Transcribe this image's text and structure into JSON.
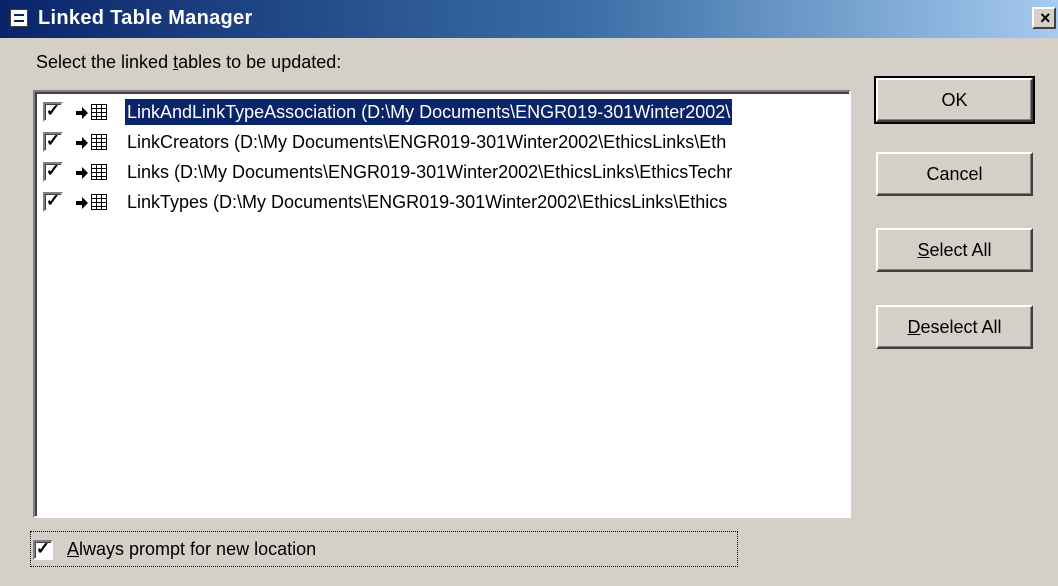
{
  "window": {
    "title": "Linked Table Manager",
    "close_glyph": "×"
  },
  "prompt": {
    "prefix": "Select the linked ",
    "mnemonic": "t",
    "suffix": "ables to be updated:"
  },
  "tables": [
    {
      "text": "LinkAndLinkTypeAssociation   (D:\\My Documents\\ENGR019-301Winter2002\\",
      "checked": true,
      "selected": true
    },
    {
      "text": "LinkCreators   (D:\\My Documents\\ENGR019-301Winter2002\\EthicsLinks\\Eth",
      "checked": true,
      "selected": false
    },
    {
      "text": "Links   (D:\\My Documents\\ENGR019-301Winter2002\\EthicsLinks\\EthicsTechr",
      "checked": true,
      "selected": false
    },
    {
      "text": "LinkTypes   (D:\\My Documents\\ENGR019-301Winter2002\\EthicsLinks\\Ethics",
      "checked": true,
      "selected": false
    }
  ],
  "buttons": {
    "ok": "OK",
    "cancel": "Cancel",
    "select_all": {
      "mnemonic": "S",
      "rest": "elect All"
    },
    "deselect_all": {
      "mnemonic": "D",
      "rest": "eselect All"
    }
  },
  "always_prompt": {
    "mnemonic": "A",
    "rest": "lways prompt for new location",
    "checked": true
  },
  "check_glyph": "✓",
  "colors": {
    "title_gradient_start": "#0a246a",
    "title_gradient_end": "#a6caf0",
    "selection": "#0a246a",
    "face": "#d4d0c8"
  }
}
